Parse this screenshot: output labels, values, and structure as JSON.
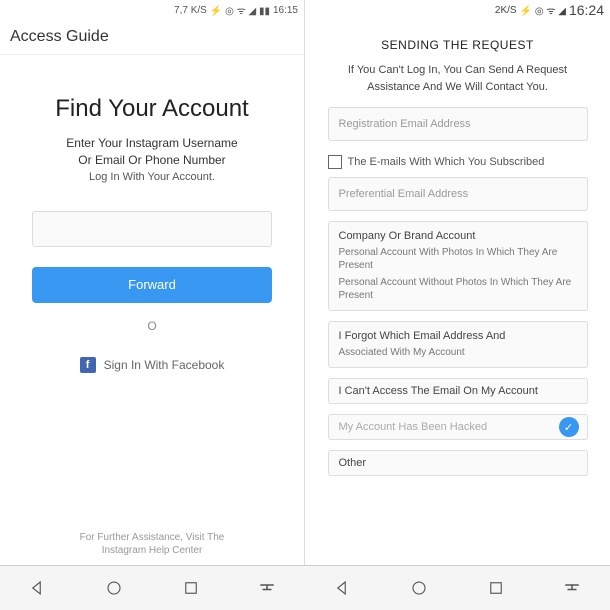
{
  "left": {
    "status": {
      "speed": "7,7 K/S",
      "time": "16:15"
    },
    "header": "Access Guide",
    "title": "Find Your Account",
    "subtitle_line1": "Enter Your Instagram Username",
    "subtitle_line2": "Or Email Or Phone Number",
    "subtext": "Log In With Your Account.",
    "forward_btn": "Forward",
    "divider": "O",
    "fb_text": "Sign In With Facebook",
    "footer_line1": "For Further Assistance, Visit The",
    "footer_line2": "Instagram Help Center"
  },
  "right": {
    "status": {
      "speed": "2K/S",
      "time": "16:24"
    },
    "title": "SENDING THE REQUEST",
    "sub": "If You Can't Log In, You Can Send A Request Assistance And We Will Contact You.",
    "field_email": "Registration Email Address",
    "checkbox_label": "The E-mails With Which You Subscribed",
    "field_pref": "Preferential Email Address",
    "options": {
      "company": "Company Or Brand Account",
      "personal_with": "Personal Account With Photos In Which They Are Present",
      "personal_without": "Personal Account Without Photos In Which They Are Present",
      "forgot": "I Forgot Which Email Address And",
      "forgot_sub": "Associated With My Account",
      "noaccess": "I Can't Access The Email On My Account",
      "hacked": "My Account Has Been Hacked",
      "other": "Other"
    }
  }
}
